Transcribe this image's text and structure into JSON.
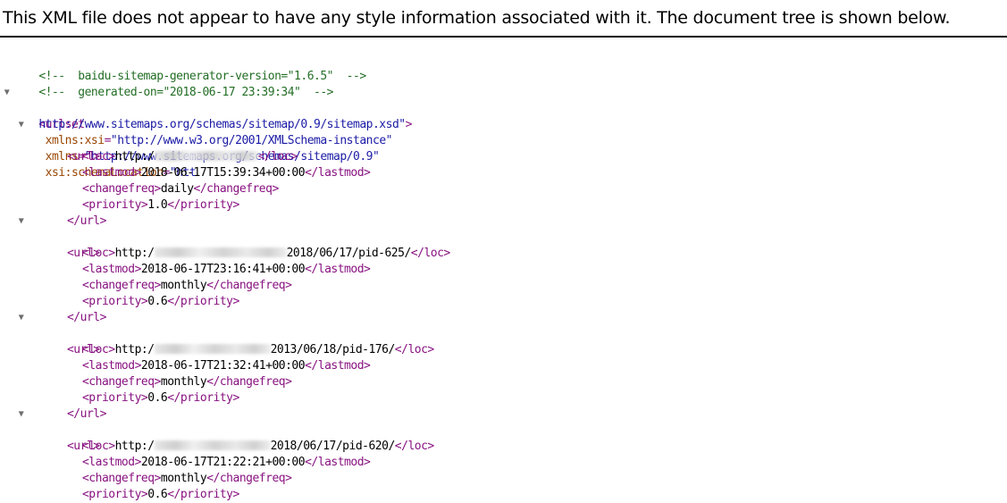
{
  "info_banner": {
    "text": "This XML file does not appear to have any style information associated with it. The document tree is shown below."
  },
  "comments": [
    "<!--  baidu-sitemap-generator-version=\"1.6.5\"  -->",
    "<!--  generated-on=\"2018-06-17 23:39:34\"  -->"
  ],
  "urlset": {
    "tag_open": "<urlset",
    "attr1_name": "xmlns:xsi",
    "attr1_value": "\"http://www.w3.org/2001/XMLSchema-instance\"",
    "attr2_name": "xmlns",
    "attr2_value": "\"http://www.sitemaps.org/schemas/sitemap/0.9\"",
    "attr3_name": "xsi:schemaLocation",
    "attr3_value_start": "\"htt",
    "attr3_value_wrap": "http://www.sitemaps.org/schemas/sitemap/0.9/sitemap.xsd\"",
    "tag_close": ">"
  },
  "toggle_glyph": "▼",
  "url_open_tag": "<url>",
  "url_close_tag": "</url>",
  "tags": {
    "loc_open": "<loc>",
    "loc_close": "</loc>",
    "lastmod_open": "<lastmod>",
    "lastmod_close": "</lastmod>",
    "changefreq_open": "<changefreq>",
    "changefreq_close": "</changefreq>",
    "priority_open": "<priority>",
    "priority_close": "</priority>"
  },
  "urls": [
    {
      "loc_prefix": "http:/",
      "loc_suffix": "",
      "lastmod": "2018-06-17T15:39:34+00:00",
      "changefreq": "daily",
      "priority": "1.0"
    },
    {
      "loc_prefix": "http:/",
      "loc_suffix": "2018/06/17/pid-625/",
      "lastmod": "2018-06-17T23:16:41+00:00",
      "changefreq": "monthly",
      "priority": "0.6"
    },
    {
      "loc_prefix": "http:/",
      "loc_suffix": "2013/06/18/pid-176/",
      "lastmod": "2018-06-17T21:32:41+00:00",
      "changefreq": "monthly",
      "priority": "0.6"
    },
    {
      "loc_prefix": "http:/",
      "loc_suffix": "2018/06/17/pid-620/",
      "lastmod": "2018-06-17T21:22:21+00:00",
      "changefreq": "monthly",
      "priority": "0.6"
    }
  ]
}
